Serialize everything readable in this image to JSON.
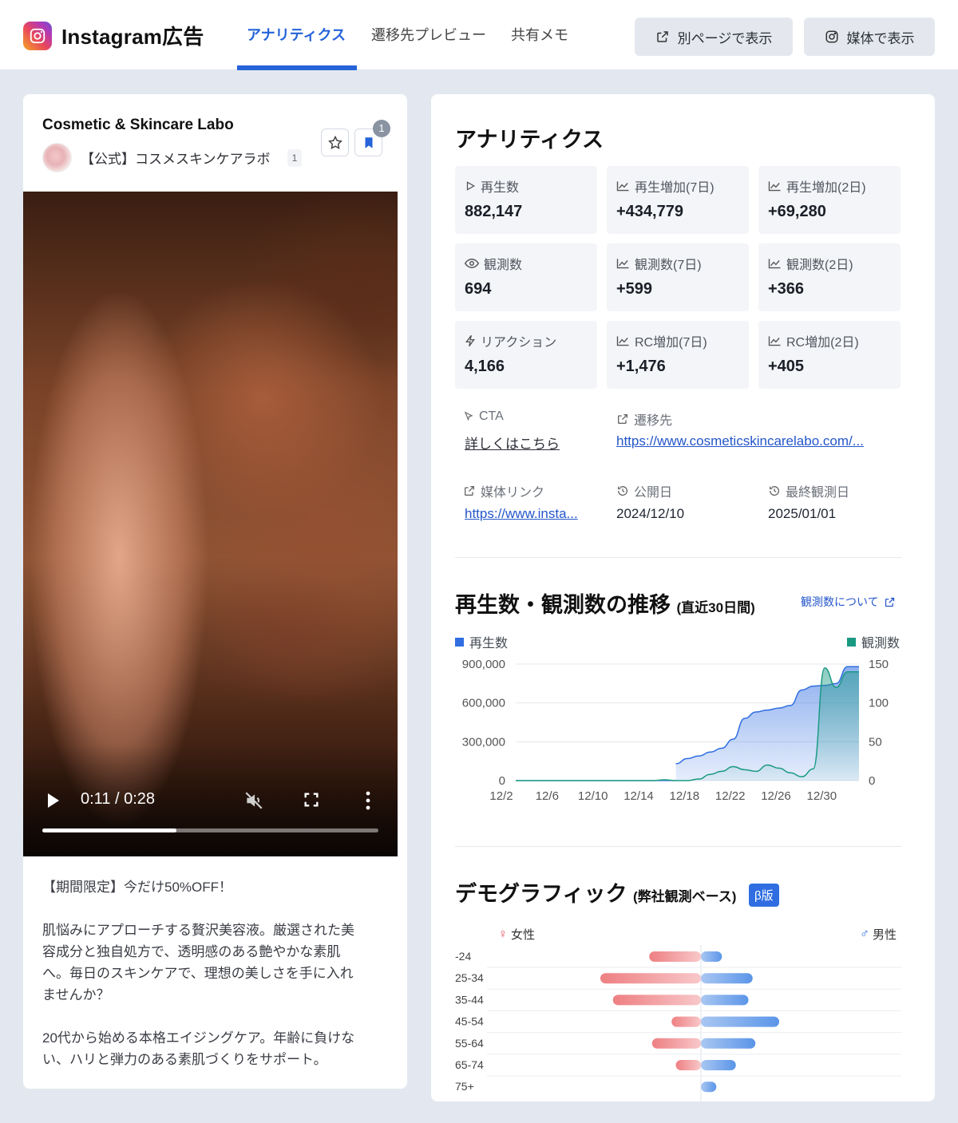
{
  "header": {
    "brand_title": "Instagram広告",
    "tabs": [
      {
        "label": "アナリティクス",
        "active": true
      },
      {
        "label": "遷移先プレビュー",
        "active": false
      },
      {
        "label": "共有メモ",
        "active": false
      }
    ],
    "btn_open_page": "別ページで表示",
    "btn_open_media": "媒体で表示"
  },
  "post": {
    "account_name": "Cosmetic & Skincare Labo",
    "account_handle": "【公式】コスメスキンケアラボ",
    "account_count": "1",
    "bookmark_count": "1",
    "video": {
      "time": "0:11 / 0:28",
      "progress": 0.4
    },
    "caption": [
      "【期間限定】今だけ50%OFF！",
      "肌悩みにアプローチする贅沢美容液。厳選された美",
      "容成分と独自処方で、透明感のある艶やかな素肌",
      "へ。毎日のスキンケアで、理想の美しさを手に入れ",
      "ませんか？",
      "20代から始める本格エイジングケア。年齢に負けな",
      "い、ハリと弾力のある素肌づくりをサポート。"
    ]
  },
  "analytics": {
    "title": "アナリティクス",
    "stats": [
      {
        "label": "再生数",
        "value": "882,147",
        "icon": "play-icon"
      },
      {
        "label": "再生増加(7日)",
        "value": "+434,779",
        "icon": "trend-icon"
      },
      {
        "label": "再生増加(2日)",
        "value": "+69,280",
        "icon": "trend-icon"
      },
      {
        "label": "観測数",
        "value": "694",
        "icon": "eye-icon"
      },
      {
        "label": "観測数(7日)",
        "value": "+599",
        "icon": "trend-icon"
      },
      {
        "label": "観測数(2日)",
        "value": "+366",
        "icon": "trend-icon"
      },
      {
        "label": "リアクション",
        "value": "4,166",
        "icon": "bolt-icon"
      },
      {
        "label": "RC増加(7日)",
        "value": "+1,476",
        "icon": "trend-icon"
      },
      {
        "label": "RC増加(2日)",
        "value": "+405",
        "icon": "trend-icon"
      }
    ],
    "cta_label": "CTA",
    "cta_value": "詳しくはこちら",
    "dest_label": "遷移先",
    "dest_value": "https://www.cosmeticskincarelabo.com/...",
    "media_link_label": "媒体リンク",
    "media_link_value": "https://www.insta...",
    "published_label": "公開日",
    "published_value": "2024/12/10",
    "last_observed_label": "最終観測日",
    "last_observed_value": "2025/01/01"
  },
  "trend": {
    "title": "再生数・観測数の推移",
    "subtitle": "(直近30日間)",
    "about_link": "観測数について",
    "colors": {
      "plays": "#2f6de1",
      "observations": "#1a9a83"
    }
  },
  "chart_data": {
    "type": "area",
    "x": [
      "12/2",
      "12/3",
      "12/4",
      "12/5",
      "12/6",
      "12/7",
      "12/8",
      "12/9",
      "12/10",
      "12/11",
      "12/12",
      "12/13",
      "12/14",
      "12/15",
      "12/16",
      "12/17",
      "12/18",
      "12/19",
      "12/20",
      "12/21",
      "12/22",
      "12/23",
      "12/24",
      "12/25",
      "12/26",
      "12/27",
      "12/28",
      "12/29",
      "12/30",
      "12/31",
      "1/1"
    ],
    "x_ticks": [
      "12/2",
      "12/6",
      "12/10",
      "12/14",
      "12/18",
      "12/22",
      "12/26",
      "12/30"
    ],
    "series": [
      {
        "name": "再生数",
        "axis": "left",
        "values": [
          0,
          0,
          0,
          0,
          0,
          0,
          0,
          0,
          0,
          0,
          0,
          0,
          0,
          0,
          130000,
          170000,
          190000,
          220000,
          250000,
          320000,
          480000,
          530000,
          545000,
          560000,
          580000,
          700000,
          730000,
          735000,
          750000,
          880000,
          880000
        ]
      },
      {
        "name": "観測数",
        "axis": "right",
        "values": [
          0,
          0,
          0,
          0,
          0,
          0,
          0,
          0,
          0,
          0,
          0,
          0,
          0,
          1,
          0,
          0,
          2,
          8,
          12,
          18,
          14,
          12,
          20,
          16,
          10,
          5,
          15,
          145,
          120,
          140,
          140
        ]
      }
    ],
    "y_left_ticks": [
      "0",
      "300,000",
      "600,000",
      "900,000"
    ],
    "y_right_ticks": [
      "0",
      "50",
      "100",
      "150"
    ],
    "ylim_left": [
      0,
      900000
    ],
    "ylim_right": [
      0,
      150
    ]
  },
  "demographics": {
    "title": "デモグラフィック",
    "subtitle": "(弊社観測ベース)",
    "beta": "β版",
    "female_label": "女性",
    "male_label": "男性",
    "colors": {
      "female": "#ee7f82",
      "male": "#5b95e8"
    },
    "rows": [
      {
        "age": "-24",
        "female": 0.37,
        "male": 0.15
      },
      {
        "age": "25-34",
        "female": 0.72,
        "male": 0.37
      },
      {
        "age": "35-44",
        "female": 0.63,
        "male": 0.34
      },
      {
        "age": "45-54",
        "female": 0.21,
        "male": 0.56
      },
      {
        "age": "55-64",
        "female": 0.35,
        "male": 0.39
      },
      {
        "age": "65-74",
        "female": 0.18,
        "male": 0.25
      },
      {
        "age": "75+",
        "female": 0.0,
        "male": 0.11
      }
    ]
  }
}
